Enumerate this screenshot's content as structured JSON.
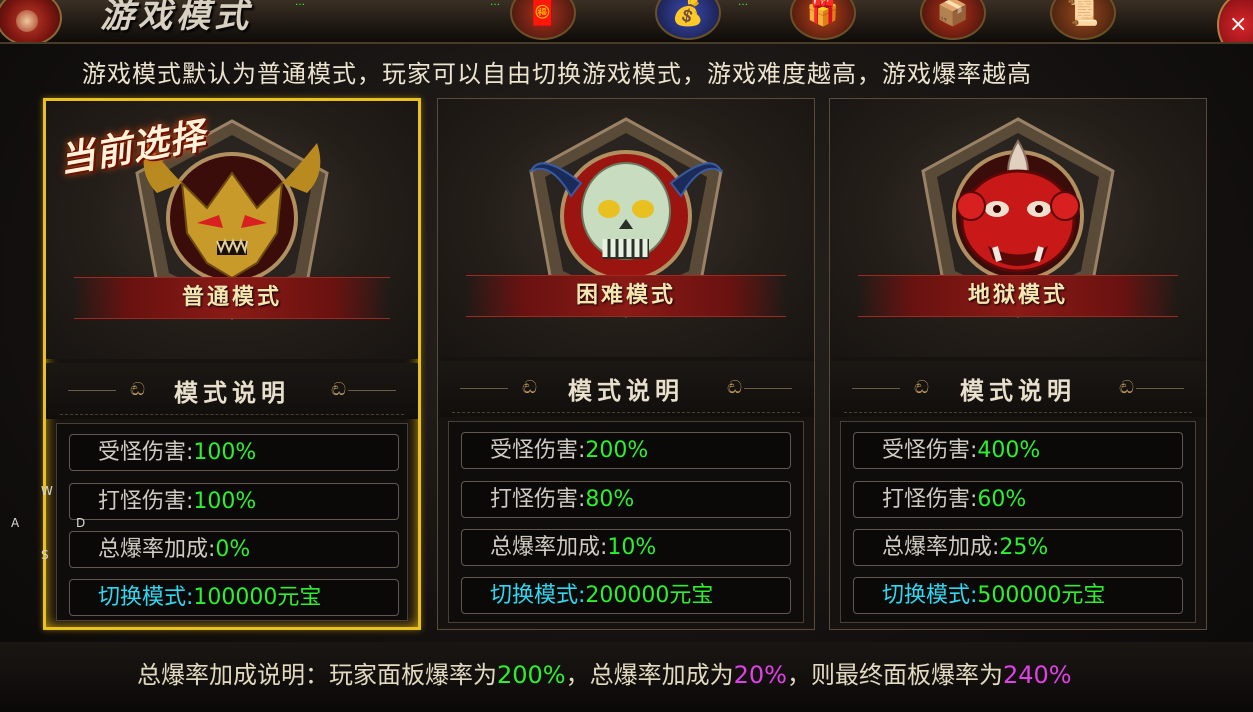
{
  "window": {
    "title": "游戏模式",
    "close_glyph": "×"
  },
  "header": {
    "tags": [
      "…",
      "…",
      "…"
    ],
    "icons": [
      {
        "name": "lucky-bag-icon",
        "glyph": "🧧"
      },
      {
        "name": "money-bag-icon",
        "glyph": "💰"
      },
      {
        "name": "red-pouch-icon",
        "glyph": "🎁"
      },
      {
        "name": "red-box-icon",
        "glyph": "📦"
      },
      {
        "name": "scroll-icon",
        "glyph": "📜"
      }
    ]
  },
  "intro": "游戏模式默认为普通模式，玩家可以自由切换游戏模式，游戏难度越高，游戏爆率越高",
  "current_label": "当前选择",
  "desc_title": "模式说明",
  "desc_ornament": "ඬ",
  "modes": [
    {
      "name": "普通模式",
      "icon": "golden-demon-mask-icon",
      "selected": true,
      "rows": [
        {
          "k": "受怪伤害:",
          "v": "100%"
        },
        {
          "k": "打怪伤害:",
          "v": "100%"
        },
        {
          "k": "总爆率加成:",
          "v": "0%"
        },
        {
          "k": "切换模式:",
          "v": "100000元宝"
        }
      ]
    },
    {
      "name": "困难模式",
      "icon": "horned-skull-icon",
      "selected": false,
      "rows": [
        {
          "k": "受怪伤害:",
          "v": "200%"
        },
        {
          "k": "打怪伤害:",
          "v": "80%"
        },
        {
          "k": "总爆率加成:",
          "v": "10%"
        },
        {
          "k": "切换模式:",
          "v": "200000元宝"
        }
      ]
    },
    {
      "name": "地狱模式",
      "icon": "red-oni-mask-icon",
      "selected": false,
      "rows": [
        {
          "k": "受怪伤害:",
          "v": "400%"
        },
        {
          "k": "打怪伤害:",
          "v": "60%"
        },
        {
          "k": "总爆率加成:",
          "v": "25%"
        },
        {
          "k": "切换模式:",
          "v": "500000元宝"
        }
      ]
    }
  ],
  "footer": {
    "t1": "总爆率加成说明：玩家面板爆率为",
    "v1": "200%",
    "t2": "，总爆率加成为",
    "v2": "20%",
    "t3": "，则最终面板爆率为",
    "v3": "240%"
  },
  "wasd": {
    "w": "W",
    "a": "A",
    "s": "S",
    "d": "D"
  },
  "colors": {
    "highlight": "#2cf02e",
    "magenta": "#e040e8",
    "switch": "#2fd8f0",
    "selected_border": "#e8c21e"
  }
}
